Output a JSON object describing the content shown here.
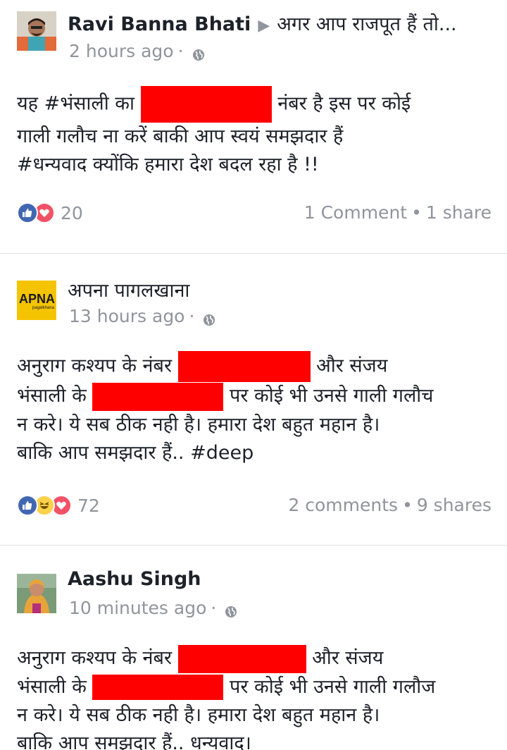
{
  "posts": [
    {
      "author": "Ravi Banna Bhati",
      "target": "अगर आप राजपूत हैं तो...",
      "time": "2 hours ago",
      "text_lines": [
        {
          "before": "यह #भंसाली का ",
          "after": " नंबर है इस पर कोई"
        },
        {
          "text": "गाली गलौच ना करें बाकी आप स्वयं समझदार हैं"
        },
        {
          "text": "#धन्यवाद क्योंकि हमारा देश बदल रहा है !!"
        }
      ],
      "reaction_count": "20",
      "comments": "1 Comment",
      "shares": "1 share"
    },
    {
      "author": "अपना पागलखाना",
      "avatar_text": "APNA",
      "avatar_subtext": "pagalkhana",
      "time": "13 hours ago",
      "text_lines": [
        {
          "before": "अनुराग कश्यप के नंबर ",
          "after": " और संजय"
        },
        {
          "before": "भंसाली के ",
          "after": " पर कोई भी उनसे गाली गलौच"
        },
        {
          "text": "न करे। ये सब ठीक नही है। हमारा देश बहुत महान है।"
        },
        {
          "text": "बाकि आप समझदार हैं.. #deep"
        }
      ],
      "reaction_count": "72",
      "comments": "2 comments",
      "shares": "9 shares"
    },
    {
      "author": "Aashu Singh",
      "time": "10 minutes ago",
      "text_lines": [
        {
          "before": "अनुराग कश्यप के नंबर ",
          "after": " और संजय"
        },
        {
          "before": "भंसाली के ",
          "after": " पर कोई भी उनसे गाली गलौज"
        },
        {
          "text": "न करे। ये सब ठीक नही है। हमारा देश बहुत महान है।"
        },
        {
          "text": "बाकि आप समझदार हैं.. धन्यवाद।"
        }
      ]
    }
  ],
  "colors": {
    "redaction": "#ff0000",
    "like": "#4267b2",
    "love": "#f25268",
    "haha": "#fbd14b",
    "meta": "#90949c",
    "divider": "#dddfe2"
  },
  "icons": [
    "globe-icon",
    "like-icon",
    "love-icon",
    "haha-icon"
  ]
}
